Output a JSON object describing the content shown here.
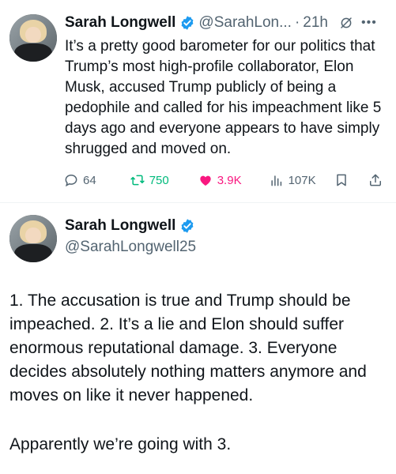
{
  "tweet1": {
    "display_name": "Sarah Longwell",
    "handle": "@SarahLon...",
    "separator": "·",
    "time": "21h",
    "text": "It’s a pretty good barometer for our politics that Trump’s most high-profile collaborator, Elon Musk, accused Trump publicly of being a pedophile and called for his impeachment like 5 days ago and everyone appears to have simply shrugged and moved on.",
    "replies": "64",
    "reposts": "750",
    "likes": "3.9K",
    "views": "107K",
    "colors": {
      "repost": "#00ba7c",
      "like": "#f91880",
      "verified": "#1d9bf0"
    }
  },
  "tweet2": {
    "display_name": "Sarah Longwell",
    "handle": "@SarahLongwell25",
    "text": "1. The accusation is true and Trump should be impeached. 2. It’s a lie and Elon should suffer enormous reputational damage. 3. Everyone decides absolutely nothing matters anymore and moves on like it never happened.",
    "text2": "Apparently we’re going with 3."
  }
}
